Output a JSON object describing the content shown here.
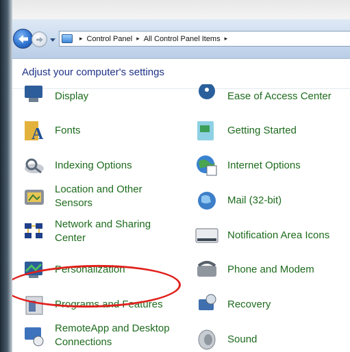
{
  "breadcrumb": {
    "crumb1": "Control Panel",
    "crumb2": "All Control Panel Items",
    "sep": "▸"
  },
  "heading": "Adjust your computer's settings",
  "items": {
    "display": "Display",
    "ease": "Ease of Access Center",
    "fonts": "Fonts",
    "getting_started": "Getting Started",
    "indexing": "Indexing Options",
    "internet": "Internet Options",
    "location": "Location and Other Sensors",
    "location_l1": "Location and Other",
    "location_l2": "Sensors",
    "mail": "Mail (32-bit)",
    "network_l1": "Network and Sharing",
    "network_l2": "Center",
    "notification": "Notification Area Icons",
    "personalization": "Personalization",
    "phone": "Phone and Modem",
    "programs": "Programs and Features",
    "recovery": "Recovery",
    "remote_l1": "RemoteApp and Desktop",
    "remote_l2": "Connections",
    "sound": "Sound"
  },
  "colors": {
    "link": "#1d6b1d",
    "heading": "#1e3287",
    "highlight": "#e0201c"
  }
}
